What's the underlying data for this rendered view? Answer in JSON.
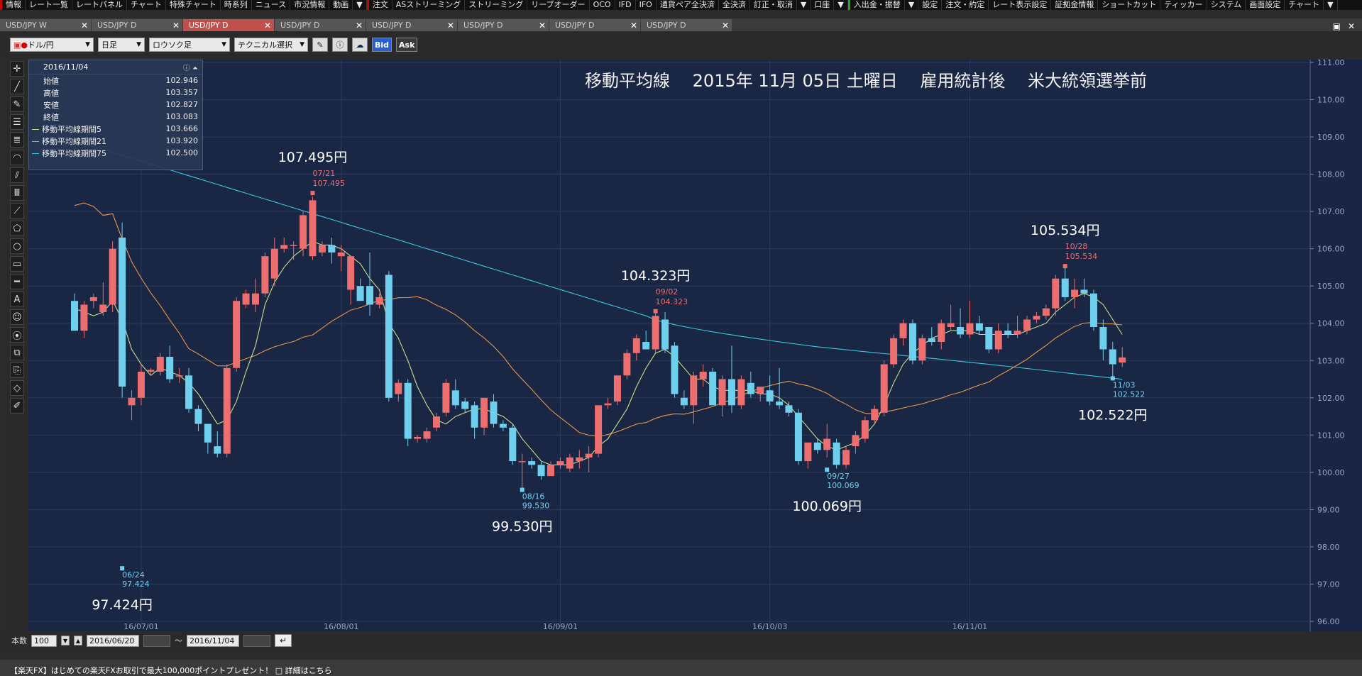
{
  "menubar": {
    "items": [
      "情報",
      "レート一覧",
      "レートパネル",
      "チャート",
      "特殊チャート",
      "時系列",
      "ニュース",
      "市況情報",
      "動画",
      "▼",
      "注文",
      "ASストリーミング",
      "ストリーミング",
      "リーブオーダー",
      "OCO",
      "IFD",
      "IFO",
      "通貨ペア全決済",
      "全決済",
      "訂正・取消",
      "▼",
      "口座",
      "▼",
      "入出金・振替",
      "▼",
      "設定",
      "注文・約定",
      "レート表示設定",
      "証拠金情報",
      "ショートカット",
      "ティッカー",
      "システム",
      "画面設定",
      "チャート",
      "▼"
    ]
  },
  "tabs": [
    {
      "label": "USD/JPY W",
      "active": false
    },
    {
      "label": "USD/JPY D",
      "active": false
    },
    {
      "label": "USD/JPY D",
      "active": true
    },
    {
      "label": "USD/JPY D",
      "active": false
    },
    {
      "label": "USD/JPY D",
      "active": false
    },
    {
      "label": "USD/JPY D",
      "active": false
    },
    {
      "label": "USD/JPY D",
      "active": false
    },
    {
      "label": "USD/JPY D",
      "active": false
    }
  ],
  "window_controls": [
    "▣",
    "✕"
  ],
  "toolbar": {
    "pair": "ドル/円",
    "period": "日足",
    "chart_type": "ロウソク足",
    "technical": "テクニカル選択",
    "bid": "Bid",
    "ask": "Ask"
  },
  "tools": [
    "✛",
    "╱",
    "✎",
    "☰",
    "≣",
    "◠",
    "⫽",
    "Ⅲ",
    "⟋",
    "⬠",
    "○",
    "▭",
    "━",
    "A",
    "☺",
    "⦿",
    "⧉",
    "⎘",
    "◇",
    "✐"
  ],
  "infobox": {
    "date": "2016/11/04",
    "rows": [
      {
        "label": "始値",
        "value": "102.946"
      },
      {
        "label": "高値",
        "value": "103.357"
      },
      {
        "label": "安値",
        "value": "102.827"
      },
      {
        "label": "終値",
        "value": "103.083"
      }
    ],
    "ma_rows": [
      {
        "label": "移動平均線期間5",
        "value": "103.666",
        "color": "#c8e08a"
      },
      {
        "label": "移動平均線期間21",
        "value": "103.920",
        "color": "#e8964a"
      },
      {
        "label": "移動平均線期間75",
        "value": "102.500",
        "color": "#3cc8d8"
      }
    ]
  },
  "chart_data": {
    "type": "candlestick",
    "title": "移動平均線　 2015年 11月 05日 土曜日　 雇用統計後　 米大統領選挙前",
    "ylim": [
      96,
      111
    ],
    "yticks": [
      "96.00",
      "97.00",
      "98.00",
      "99.00",
      "100.00",
      "101.00",
      "102.00",
      "103.00",
      "104.00",
      "105.00",
      "106.00",
      "107.00",
      "108.00",
      "109.00",
      "110.00",
      "111.00"
    ],
    "xticks": [
      {
        "index": 7,
        "label": "16/07/01"
      },
      {
        "index": 28,
        "label": "16/08/01"
      },
      {
        "index": 51,
        "label": "16/09/01"
      },
      {
        "index": 73,
        "label": "16/10/03"
      },
      {
        "index": 94,
        "label": "16/11/01"
      }
    ],
    "candles": [
      [
        104.6,
        104.8,
        103.8,
        103.8
      ],
      [
        103.8,
        104.6,
        103.6,
        104.5
      ],
      [
        104.6,
        104.8,
        104.4,
        104.7
      ],
      [
        104.3,
        105.1,
        104.2,
        104.5
      ],
      [
        104.5,
        106.2,
        104.3,
        106.0
      ],
      [
        106.3,
        106.7,
        102.0,
        102.3
      ],
      [
        101.8,
        102.2,
        101.4,
        102.0
      ],
      [
        102.0,
        102.9,
        101.8,
        102.7
      ],
      [
        102.7,
        102.8,
        102.6,
        102.75
      ],
      [
        102.7,
        103.2,
        102.6,
        103.1
      ],
      [
        103.1,
        103.4,
        102.4,
        102.5
      ],
      [
        102.6,
        102.8,
        102.4,
        102.6
      ],
      [
        102.6,
        102.8,
        101.6,
        101.7
      ],
      [
        101.7,
        101.8,
        101.1,
        101.3
      ],
      [
        101.3,
        101.3,
        100.5,
        100.8
      ],
      [
        100.7,
        101.1,
        100.4,
        100.5
      ],
      [
        100.5,
        102.9,
        100.4,
        102.8
      ],
      [
        102.8,
        104.7,
        102.7,
        104.6
      ],
      [
        104.5,
        104.9,
        104.4,
        104.8
      ],
      [
        104.5,
        105.2,
        104.3,
        104.8
      ],
      [
        104.8,
        105.9,
        104.7,
        105.8
      ],
      [
        105.2,
        106.3,
        105.0,
        106.0
      ],
      [
        106.0,
        106.3,
        105.9,
        106.1
      ],
      [
        106.1,
        106.2,
        105.7,
        106.1
      ],
      [
        106.0,
        107.0,
        105.8,
        106.9
      ],
      [
        105.8,
        107.4,
        105.7,
        107.3
      ],
      [
        105.9,
        106.2,
        105.8,
        106.1
      ],
      [
        106.1,
        106.3,
        105.6,
        105.9
      ],
      [
        105.8,
        106.1,
        105.4,
        105.9
      ],
      [
        104.9,
        105.8,
        104.5,
        105.8
      ],
      [
        105.0,
        105.2,
        104.6,
        104.6
      ],
      [
        105.0,
        105.9,
        104.2,
        104.5
      ],
      [
        104.5,
        104.8,
        104.4,
        104.7
      ],
      [
        105.3,
        105.4,
        101.9,
        102.0
      ],
      [
        102.1,
        102.5,
        101.9,
        102.4
      ],
      [
        102.4,
        102.5,
        100.7,
        100.9
      ],
      [
        100.9,
        101.0,
        100.8,
        100.95
      ],
      [
        100.9,
        101.2,
        100.8,
        101.1
      ],
      [
        101.2,
        101.6,
        101.1,
        101.5
      ],
      [
        101.6,
        102.5,
        101.5,
        102.4
      ],
      [
        102.2,
        102.5,
        101.7,
        101.8
      ],
      [
        101.9,
        102.0,
        101.6,
        101.7
      ],
      [
        101.8,
        101.9,
        100.9,
        101.2
      ],
      [
        101.2,
        102.0,
        101.0,
        102.0
      ],
      [
        101.9,
        102.1,
        101.2,
        101.3
      ],
      [
        101.3,
        101.4,
        101.1,
        101.2
      ],
      [
        101.2,
        101.3,
        100.2,
        100.3
      ],
      [
        100.3,
        100.5,
        99.5,
        100.3
      ],
      [
        100.3,
        100.4,
        100.1,
        100.2
      ],
      [
        100.2,
        100.3,
        99.8,
        99.9
      ],
      [
        99.9,
        100.3,
        99.9,
        100.2
      ],
      [
        100.2,
        100.4,
        100.1,
        100.3
      ],
      [
        100.1,
        100.5,
        100.0,
        100.4
      ],
      [
        100.3,
        100.6,
        100.1,
        100.4
      ],
      [
        100.4,
        100.7,
        100.0,
        100.5
      ],
      [
        100.5,
        101.8,
        100.4,
        101.8
      ],
      [
        101.8,
        102.0,
        101.7,
        101.85
      ],
      [
        101.9,
        102.6,
        101.8,
        102.6
      ],
      [
        102.6,
        103.3,
        102.5,
        103.2
      ],
      [
        103.2,
        103.7,
        103.0,
        103.6
      ],
      [
        103.5,
        103.8,
        103.3,
        103.3
      ],
      [
        103.3,
        104.3,
        103.2,
        104.2
      ],
      [
        104.1,
        104.3,
        103.2,
        103.3
      ],
      [
        103.4,
        103.5,
        102.0,
        102.1
      ],
      [
        102.0,
        102.2,
        101.7,
        101.8
      ],
      [
        101.8,
        102.7,
        101.3,
        102.6
      ],
      [
        102.5,
        102.9,
        102.3,
        102.7
      ],
      [
        102.7,
        102.8,
        101.8,
        101.8
      ],
      [
        101.8,
        102.6,
        101.5,
        102.5
      ],
      [
        102.5,
        103.4,
        101.6,
        101.8
      ],
      [
        101.8,
        102.6,
        101.7,
        102.5
      ],
      [
        102.4,
        102.7,
        102.0,
        102.1
      ],
      [
        102.1,
        102.3,
        101.9,
        102.3
      ],
      [
        102.2,
        102.6,
        101.8,
        101.9
      ],
      [
        101.9,
        102.8,
        101.7,
        101.8
      ],
      [
        101.8,
        101.9,
        101.5,
        101.6
      ],
      [
        101.6,
        101.7,
        100.2,
        100.3
      ],
      [
        100.3,
        100.8,
        100.1,
        100.8
      ],
      [
        100.8,
        100.9,
        100.5,
        100.6
      ],
      [
        100.6,
        101.3,
        100.4,
        100.9
      ],
      [
        100.8,
        100.9,
        100.1,
        100.2
      ],
      [
        100.2,
        100.7,
        100.1,
        100.6
      ],
      [
        100.7,
        101.1,
        100.5,
        101.0
      ],
      [
        100.9,
        101.5,
        100.8,
        101.4
      ],
      [
        101.4,
        101.8,
        101.3,
        101.7
      ],
      [
        101.6,
        103.0,
        101.5,
        102.9
      ],
      [
        102.9,
        103.7,
        102.8,
        103.6
      ],
      [
        103.6,
        104.1,
        103.4,
        104.0
      ],
      [
        104.0,
        104.1,
        102.9,
        103.0
      ],
      [
        103.0,
        103.7,
        102.9,
        103.6
      ],
      [
        103.6,
        103.9,
        103.4,
        103.5
      ],
      [
        103.5,
        104.1,
        103.3,
        104.0
      ],
      [
        103.9,
        104.5,
        103.8,
        104.0
      ],
      [
        103.9,
        104.4,
        103.6,
        103.7
      ],
      [
        103.7,
        104.6,
        103.6,
        104.0
      ],
      [
        104.0,
        104.2,
        103.7,
        103.8
      ],
      [
        103.9,
        103.9,
        103.2,
        103.3
      ],
      [
        103.3,
        104.0,
        103.2,
        103.8
      ],
      [
        103.8,
        104.0,
        103.6,
        103.7
      ],
      [
        103.7,
        104.2,
        103.6,
        103.8
      ],
      [
        103.8,
        104.2,
        103.7,
        104.1
      ],
      [
        104.1,
        104.3,
        104.0,
        104.2
      ],
      [
        104.2,
        104.5,
        104.1,
        104.4
      ],
      [
        104.4,
        105.3,
        104.2,
        105.2
      ],
      [
        105.2,
        105.534,
        104.6,
        104.7
      ],
      [
        104.7,
        105.2,
        104.4,
        104.9
      ],
      [
        104.9,
        105.2,
        104.7,
        104.8
      ],
      [
        104.8,
        104.9,
        103.8,
        103.9
      ],
      [
        103.9,
        104.1,
        103.0,
        103.3
      ],
      [
        103.3,
        103.5,
        102.522,
        102.9
      ],
      [
        102.946,
        103.357,
        102.827,
        103.083
      ]
    ],
    "ma5": [
      104.4,
      104.3,
      104.2,
      104.3,
      104.6,
      104.1,
      103.3,
      102.9,
      102.6,
      102.8,
      102.7,
      102.6,
      102.4,
      102.1,
      101.7,
      101.3,
      101.4,
      101.9,
      102.7,
      103.4,
      104.5,
      105.1,
      105.5,
      105.8,
      106.0,
      106.2,
      106.1,
      106.1,
      106.0,
      105.8,
      105.6,
      105.2,
      104.9,
      104.0,
      103.6,
      103.0,
      102.3,
      101.8,
      101.4,
      101.3,
      101.5,
      101.6,
      101.7,
      101.7,
      101.6,
      101.5,
      101.3,
      100.9,
      100.6,
      100.3,
      100.2,
      100.2,
      100.2,
      100.3,
      100.4,
      100.7,
      100.9,
      101.3,
      101.7,
      102.3,
      102.8,
      103.2,
      103.3,
      103.1,
      102.8,
      102.5,
      102.5,
      102.3,
      102.2,
      102.2,
      102.2,
      102.2,
      102.1,
      102.1,
      102.0,
      101.8,
      101.5,
      101.2,
      100.9,
      100.7,
      100.6,
      100.7,
      100.8,
      101.0,
      101.3,
      101.8,
      102.4,
      102.9,
      103.2,
      103.4,
      103.6,
      103.7,
      103.8,
      103.8,
      103.8,
      103.7,
      103.7,
      103.7,
      103.7,
      103.7,
      103.8,
      103.9,
      104.0,
      104.3,
      104.5,
      104.7,
      104.8,
      104.7,
      104.5,
      104.1,
      103.7
    ]
  },
  "chart_annotations": [
    {
      "label": "107.495円",
      "index": 25,
      "price": 107.495,
      "date": "07/21",
      "value": "107.495",
      "type": "high"
    },
    {
      "label": "97.424円",
      "index": 5,
      "price": 97.424,
      "date": "06/24",
      "value": "97.424",
      "type": "low"
    },
    {
      "label": "99.530円",
      "index": 47,
      "price": 99.53,
      "date": "08/16",
      "value": "99.530",
      "type": "low"
    },
    {
      "label": "104.323円",
      "index": 61,
      "price": 104.323,
      "date": "09/02",
      "value": "104.323",
      "type": "high"
    },
    {
      "label": "100.069円",
      "index": 79,
      "price": 100.069,
      "date": "09/27",
      "value": "100.069",
      "type": "low"
    },
    {
      "label": "105.534円",
      "index": 104,
      "price": 105.534,
      "date": "10/28",
      "value": "105.534",
      "type": "high"
    },
    {
      "label": "102.522円",
      "index": 109,
      "price": 102.522,
      "date": "11/03",
      "value": "102.522",
      "type": "low"
    }
  ],
  "bottombar": {
    "count_label": "本数",
    "count_value": "100",
    "from_date": "2016/06/20",
    "tilde": "〜",
    "to_date": "2016/11/04",
    "go": "↵"
  },
  "statusbar": {
    "text": "【楽天FX】はじめての楽天FXお取引で最大100,000ポイントプレゼント！ □ 詳細はこちら"
  },
  "colors": {
    "up": "#ec6e6e",
    "down": "#6fd0ee",
    "bg": "#192644",
    "ma5": "#c8e08a",
    "ma21": "#e8964a",
    "ma75": "#3cc8d8"
  }
}
